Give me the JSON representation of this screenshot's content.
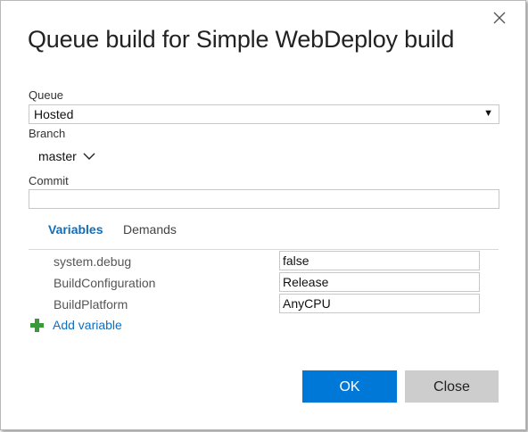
{
  "dialog": {
    "title": "Queue build for Simple WebDeploy build"
  },
  "queue": {
    "label": "Queue",
    "value": "Hosted",
    "caret": "▼"
  },
  "branch": {
    "label": "Branch",
    "value": "master"
  },
  "commit": {
    "label": "Commit",
    "value": ""
  },
  "tabs": [
    {
      "label": "Variables",
      "active": true
    },
    {
      "label": "Demands",
      "active": false
    }
  ],
  "variables": [
    {
      "name": "system.debug",
      "value": "false"
    },
    {
      "name": "BuildConfiguration",
      "value": "Release"
    },
    {
      "name": "BuildPlatform",
      "value": "AnyCPU"
    }
  ],
  "add_variable": {
    "label": "Add variable",
    "icon": "plus-icon",
    "color": "#3a9a3a"
  },
  "buttons": {
    "ok": "OK",
    "close": "Close"
  },
  "colors": {
    "accent": "#0078d7",
    "link": "#106ebe",
    "secondary_button": "#cdcdcd"
  }
}
